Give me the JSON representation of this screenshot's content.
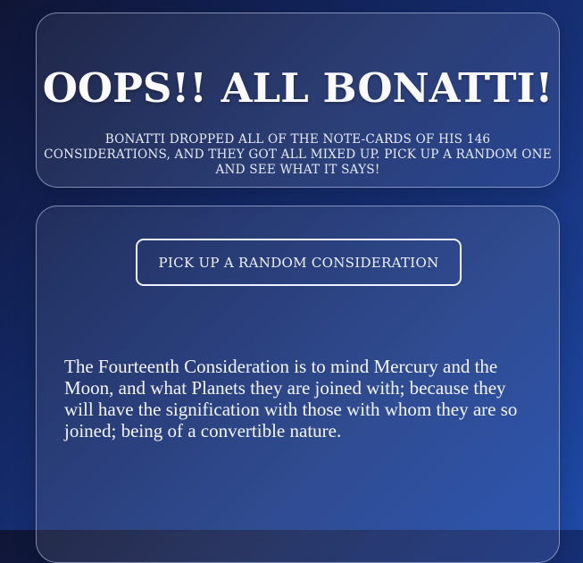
{
  "header": {
    "title": "OOPS!! ALL BONATTI!",
    "subtitle": "BONATTI DROPPED ALL OF THE NOTE-CARDS OF HIS 146 CONSIDERATIONS, AND THEY GOT ALL MIXED UP. PICK UP A RANDOM ONE AND SEE WHAT IT SAYS!"
  },
  "main": {
    "button_label": "PICK UP A RANDOM CONSIDERATION",
    "consideration": "The Fourteenth Consideration is to mind Mercury and the Moon, and what Planets they are joined with; because they will have the signification with those with whom they are so joined; being of a convertible nature."
  }
}
